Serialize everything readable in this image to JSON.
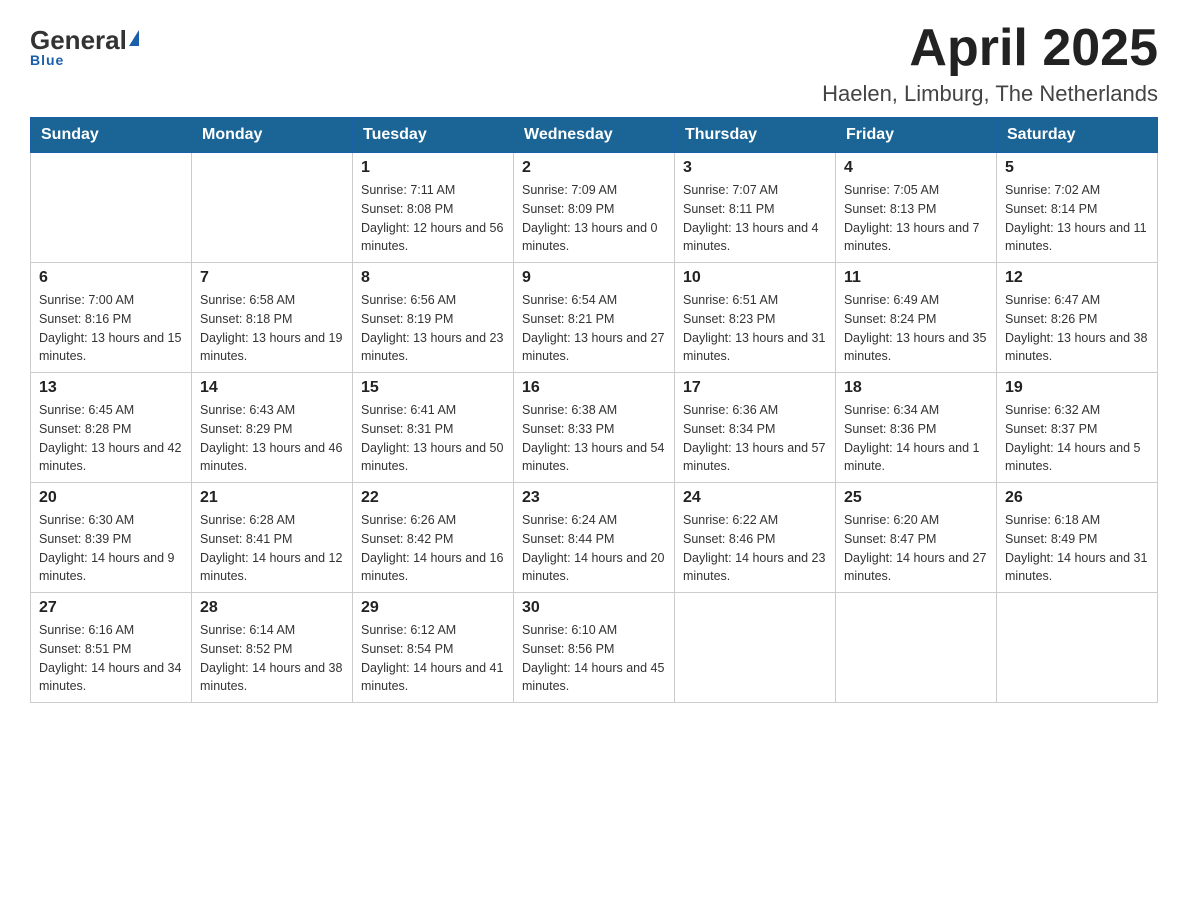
{
  "header": {
    "logo_general": "General",
    "logo_blue": "Blue",
    "title": "April 2025",
    "subtitle": "Haelen, Limburg, The Netherlands"
  },
  "weekdays": [
    "Sunday",
    "Monday",
    "Tuesday",
    "Wednesday",
    "Thursday",
    "Friday",
    "Saturday"
  ],
  "weeks": [
    [
      {
        "day": "",
        "sunrise": "",
        "sunset": "",
        "daylight": ""
      },
      {
        "day": "",
        "sunrise": "",
        "sunset": "",
        "daylight": ""
      },
      {
        "day": "1",
        "sunrise": "Sunrise: 7:11 AM",
        "sunset": "Sunset: 8:08 PM",
        "daylight": "Daylight: 12 hours and 56 minutes."
      },
      {
        "day": "2",
        "sunrise": "Sunrise: 7:09 AM",
        "sunset": "Sunset: 8:09 PM",
        "daylight": "Daylight: 13 hours and 0 minutes."
      },
      {
        "day": "3",
        "sunrise": "Sunrise: 7:07 AM",
        "sunset": "Sunset: 8:11 PM",
        "daylight": "Daylight: 13 hours and 4 minutes."
      },
      {
        "day": "4",
        "sunrise": "Sunrise: 7:05 AM",
        "sunset": "Sunset: 8:13 PM",
        "daylight": "Daylight: 13 hours and 7 minutes."
      },
      {
        "day": "5",
        "sunrise": "Sunrise: 7:02 AM",
        "sunset": "Sunset: 8:14 PM",
        "daylight": "Daylight: 13 hours and 11 minutes."
      }
    ],
    [
      {
        "day": "6",
        "sunrise": "Sunrise: 7:00 AM",
        "sunset": "Sunset: 8:16 PM",
        "daylight": "Daylight: 13 hours and 15 minutes."
      },
      {
        "day": "7",
        "sunrise": "Sunrise: 6:58 AM",
        "sunset": "Sunset: 8:18 PM",
        "daylight": "Daylight: 13 hours and 19 minutes."
      },
      {
        "day": "8",
        "sunrise": "Sunrise: 6:56 AM",
        "sunset": "Sunset: 8:19 PM",
        "daylight": "Daylight: 13 hours and 23 minutes."
      },
      {
        "day": "9",
        "sunrise": "Sunrise: 6:54 AM",
        "sunset": "Sunset: 8:21 PM",
        "daylight": "Daylight: 13 hours and 27 minutes."
      },
      {
        "day": "10",
        "sunrise": "Sunrise: 6:51 AM",
        "sunset": "Sunset: 8:23 PM",
        "daylight": "Daylight: 13 hours and 31 minutes."
      },
      {
        "day": "11",
        "sunrise": "Sunrise: 6:49 AM",
        "sunset": "Sunset: 8:24 PM",
        "daylight": "Daylight: 13 hours and 35 minutes."
      },
      {
        "day": "12",
        "sunrise": "Sunrise: 6:47 AM",
        "sunset": "Sunset: 8:26 PM",
        "daylight": "Daylight: 13 hours and 38 minutes."
      }
    ],
    [
      {
        "day": "13",
        "sunrise": "Sunrise: 6:45 AM",
        "sunset": "Sunset: 8:28 PM",
        "daylight": "Daylight: 13 hours and 42 minutes."
      },
      {
        "day": "14",
        "sunrise": "Sunrise: 6:43 AM",
        "sunset": "Sunset: 8:29 PM",
        "daylight": "Daylight: 13 hours and 46 minutes."
      },
      {
        "day": "15",
        "sunrise": "Sunrise: 6:41 AM",
        "sunset": "Sunset: 8:31 PM",
        "daylight": "Daylight: 13 hours and 50 minutes."
      },
      {
        "day": "16",
        "sunrise": "Sunrise: 6:38 AM",
        "sunset": "Sunset: 8:33 PM",
        "daylight": "Daylight: 13 hours and 54 minutes."
      },
      {
        "day": "17",
        "sunrise": "Sunrise: 6:36 AM",
        "sunset": "Sunset: 8:34 PM",
        "daylight": "Daylight: 13 hours and 57 minutes."
      },
      {
        "day": "18",
        "sunrise": "Sunrise: 6:34 AM",
        "sunset": "Sunset: 8:36 PM",
        "daylight": "Daylight: 14 hours and 1 minute."
      },
      {
        "day": "19",
        "sunrise": "Sunrise: 6:32 AM",
        "sunset": "Sunset: 8:37 PM",
        "daylight": "Daylight: 14 hours and 5 minutes."
      }
    ],
    [
      {
        "day": "20",
        "sunrise": "Sunrise: 6:30 AM",
        "sunset": "Sunset: 8:39 PM",
        "daylight": "Daylight: 14 hours and 9 minutes."
      },
      {
        "day": "21",
        "sunrise": "Sunrise: 6:28 AM",
        "sunset": "Sunset: 8:41 PM",
        "daylight": "Daylight: 14 hours and 12 minutes."
      },
      {
        "day": "22",
        "sunrise": "Sunrise: 6:26 AM",
        "sunset": "Sunset: 8:42 PM",
        "daylight": "Daylight: 14 hours and 16 minutes."
      },
      {
        "day": "23",
        "sunrise": "Sunrise: 6:24 AM",
        "sunset": "Sunset: 8:44 PM",
        "daylight": "Daylight: 14 hours and 20 minutes."
      },
      {
        "day": "24",
        "sunrise": "Sunrise: 6:22 AM",
        "sunset": "Sunset: 8:46 PM",
        "daylight": "Daylight: 14 hours and 23 minutes."
      },
      {
        "day": "25",
        "sunrise": "Sunrise: 6:20 AM",
        "sunset": "Sunset: 8:47 PM",
        "daylight": "Daylight: 14 hours and 27 minutes."
      },
      {
        "day": "26",
        "sunrise": "Sunrise: 6:18 AM",
        "sunset": "Sunset: 8:49 PM",
        "daylight": "Daylight: 14 hours and 31 minutes."
      }
    ],
    [
      {
        "day": "27",
        "sunrise": "Sunrise: 6:16 AM",
        "sunset": "Sunset: 8:51 PM",
        "daylight": "Daylight: 14 hours and 34 minutes."
      },
      {
        "day": "28",
        "sunrise": "Sunrise: 6:14 AM",
        "sunset": "Sunset: 8:52 PM",
        "daylight": "Daylight: 14 hours and 38 minutes."
      },
      {
        "day": "29",
        "sunrise": "Sunrise: 6:12 AM",
        "sunset": "Sunset: 8:54 PM",
        "daylight": "Daylight: 14 hours and 41 minutes."
      },
      {
        "day": "30",
        "sunrise": "Sunrise: 6:10 AM",
        "sunset": "Sunset: 8:56 PM",
        "daylight": "Daylight: 14 hours and 45 minutes."
      },
      {
        "day": "",
        "sunrise": "",
        "sunset": "",
        "daylight": ""
      },
      {
        "day": "",
        "sunrise": "",
        "sunset": "",
        "daylight": ""
      },
      {
        "day": "",
        "sunrise": "",
        "sunset": "",
        "daylight": ""
      }
    ]
  ]
}
